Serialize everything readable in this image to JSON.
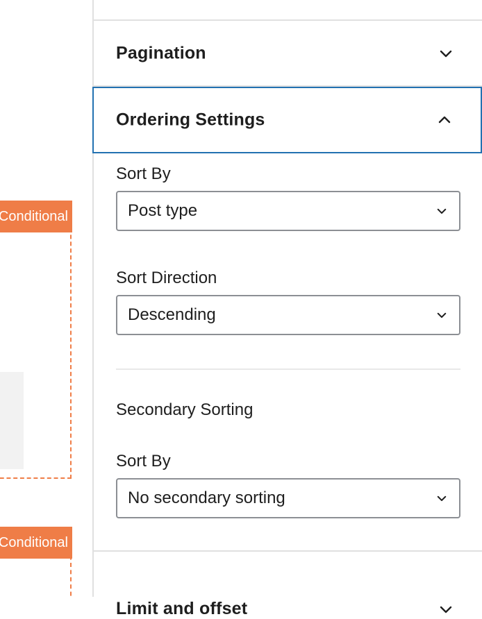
{
  "canvas": {
    "tags": [
      {
        "label": "Conditional"
      },
      {
        "label": "Conditional"
      }
    ]
  },
  "sidebar": {
    "panels": {
      "pagination": {
        "title": "Pagination",
        "expanded": false,
        "icon": "chevron-down-icon"
      },
      "ordering": {
        "title": "Ordering Settings",
        "expanded": true,
        "icon": "chevron-up-icon"
      },
      "limit": {
        "title": "Limit and offset",
        "expanded": false,
        "icon": "chevron-down-icon"
      }
    },
    "ordering_fields": {
      "sort_by_label": "Sort By",
      "sort_by_value": "Post type",
      "sort_direction_label": "Sort Direction",
      "sort_direction_value": "Descending",
      "secondary_heading": "Secondary Sorting",
      "secondary_sort_by_label": "Sort By",
      "secondary_sort_by_value": "No secondary sorting"
    }
  },
  "colors": {
    "accent": "#2271b1",
    "conditional": "#ef7d47",
    "border": "#8c8f94"
  }
}
